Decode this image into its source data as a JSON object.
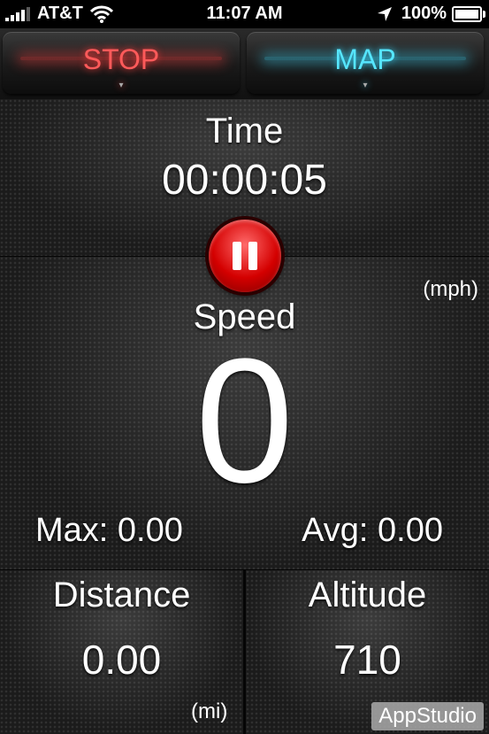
{
  "status_bar": {
    "carrier": "AT&T",
    "time": "11:07 AM",
    "battery": "100%",
    "battery_level": 1.0
  },
  "toolbar": {
    "stop_label": "STOP",
    "map_label": "MAP"
  },
  "time_panel": {
    "label": "Time",
    "value": "00:00:05"
  },
  "speed_panel": {
    "label": "Speed",
    "unit": "(mph)",
    "value": "0",
    "max": "Max: 0.00",
    "avg": "Avg: 0.00"
  },
  "distance_panel": {
    "label": "Distance",
    "value": "0.00",
    "unit": "(mi)"
  },
  "altitude_panel": {
    "label": "Altitude",
    "value": "710"
  },
  "watermark": "AppStudio"
}
